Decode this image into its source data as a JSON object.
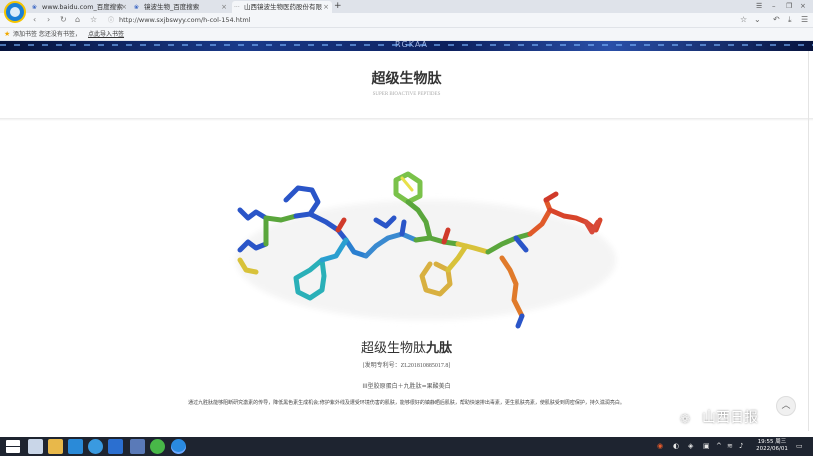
{
  "browser": {
    "tabs": [
      {
        "label": "www.baidu.com_百度搜索",
        "close": "×"
      },
      {
        "label": "镜波生物_百度搜索",
        "close": "×"
      },
      {
        "label": "山西镜波生物医药股份有限",
        "close": "×"
      }
    ],
    "new_tab": "+",
    "url": "http://www.sxjbswyy.com/h-col-154.html",
    "window_controls": {
      "menu": "☰",
      "minimize": "–",
      "maximize": "❐",
      "close": "×"
    }
  },
  "bookmarks": {
    "prompt": "添加书签  您还没有书签，",
    "import_link": "点此导入书签"
  },
  "page": {
    "banner_glyph": "RGKAA",
    "section_title": "超级生物肽",
    "section_subtitle": "SUPER BIOACTIVE PEPTIDES",
    "product_title_prefix": "超级生物肽",
    "product_title_bold": "九肽",
    "patent": "[发明专利号：ZL201810885017.8]",
    "formula": "III型胶原蛋白＋九胜肽=果酸美白",
    "description": "通过九胜肽能够阻断研究激素的传导，降低黑色素生成机会;修护紫外线及遭受环境伤害的肌肤，能够很好的镇静晒后肌肤，帮助快速排出毒素，更生肌肤亮素，使肌肤受到周密保护，持久滋润亮白。",
    "back_to_top": "︿",
    "watermark": "山西日报"
  },
  "taskbar": {
    "clock_time": "19:55 周三",
    "clock_date": "2022/06/01"
  },
  "colors": {
    "banner": "#0c1f5c",
    "accent": "#1a7fd6",
    "taskbar": "#1e2430"
  }
}
